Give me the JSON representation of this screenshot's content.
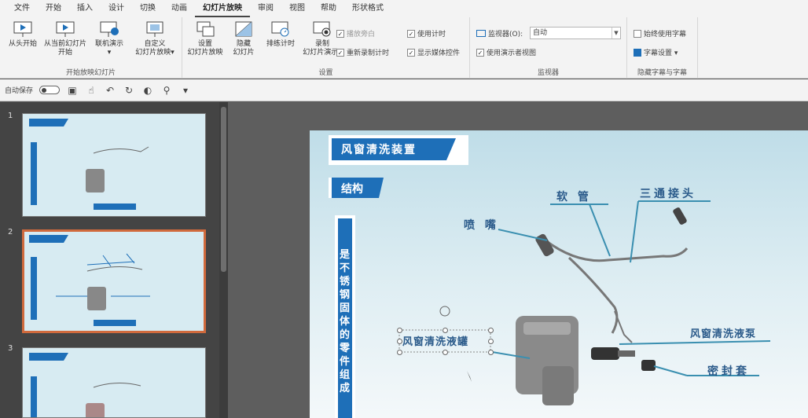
{
  "menu": [
    "文件",
    "开始",
    "插入",
    "设计",
    "切换",
    "动画",
    "幻灯片放映",
    "审阅",
    "视图",
    "帮助",
    "形状格式"
  ],
  "menu_active": 6,
  "ribbon": {
    "group1": {
      "title": "开始放映幻灯片",
      "buttons": [
        "从头开始",
        "从当前幻灯片\n开始",
        "联机演示\n▾",
        "自定义\n幻灯片放映▾"
      ]
    },
    "group2": {
      "title": "设置",
      "buttons": [
        "设置\n幻灯片放映",
        "隐藏\n幻灯片",
        "排练计时",
        "录制\n幻灯片演示▾"
      ],
      "checks": [
        {
          "label": "使用计时",
          "checked": true
        },
        {
          "label": "显示媒体控件",
          "checked": true
        },
        {
          "label": "播放旁白",
          "checked": true
        },
        {
          "label": "重新录制计时",
          "checked": false
        }
      ]
    },
    "group3": {
      "title": "监视器",
      "monitor_label": "监视器(O):",
      "monitor_value": "自动",
      "presenter_view": "使用演示者视图"
    },
    "group4": {
      "title": "隐藏字幕与字幕",
      "always_subtitles": "始终使用字幕",
      "subtitle_settings": "字幕设置 ▾"
    }
  },
  "qat": {
    "autosave": "自动保存"
  },
  "slides": [
    {
      "number": "1"
    },
    {
      "number": "2"
    },
    {
      "number": "3"
    }
  ],
  "slide": {
    "title": "风窗清洗装置",
    "subtitle": "结构",
    "side_text": "是不锈钢固体的零件组成",
    "labels": {
      "hose": "软 管",
      "tee": "三通接头",
      "nozzle": "喷 嘴",
      "reservoir": "风窗清洗液罐",
      "pump": "风窗清洗液泵",
      "seal": "密封套"
    }
  },
  "colors": {
    "accent": "#1e6fb8",
    "selected": "#d06a3d"
  }
}
